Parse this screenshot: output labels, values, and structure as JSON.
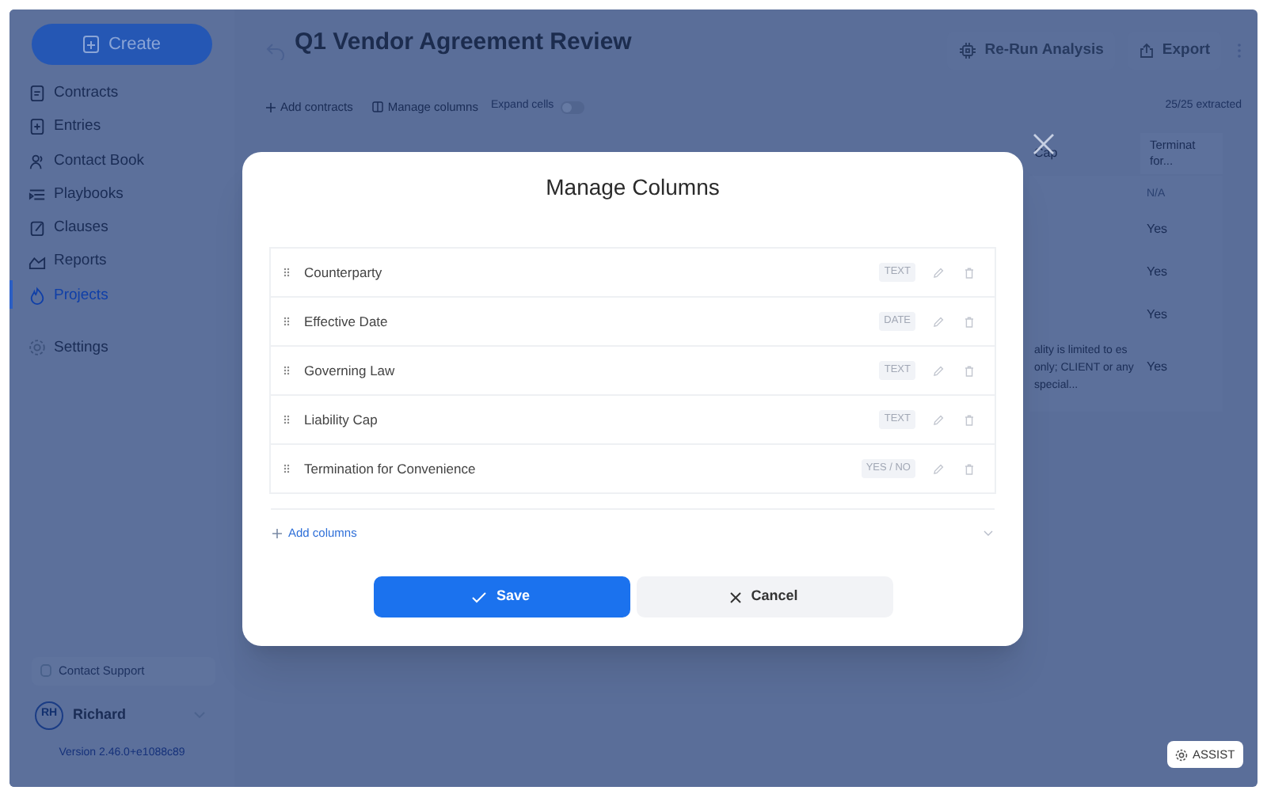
{
  "sidebar": {
    "create_button": "Create",
    "items": [
      {
        "label": "Contracts",
        "selected": false
      },
      {
        "label": "Entries",
        "selected": false
      },
      {
        "label": "Contact Book",
        "selected": false
      },
      {
        "label": "Playbooks",
        "selected": false
      },
      {
        "label": "Clauses",
        "selected": false
      },
      {
        "label": "Reports",
        "selected": false
      },
      {
        "label": "Projects",
        "selected": true
      }
    ],
    "settings": "Settings",
    "contact_support": "Contact Support",
    "user": {
      "initials": "RH",
      "name": "Richard"
    },
    "version": "Version 2.46.0+e1088c89"
  },
  "header": {
    "title": "Q1 Vendor Agreement Review",
    "rerun_button": "Re-Run Analysis",
    "export_button": "Export"
  },
  "toolbar": {
    "add_contracts": "Add contracts",
    "manage_columns": "Manage columns",
    "expand_cells": {
      "label": "Expand cells",
      "on": false
    },
    "extracted": "25/25 extracted"
  },
  "table": {
    "columns": [
      "Cap",
      "Terminat for..."
    ],
    "rows": [
      [
        "",
        "N/A"
      ],
      [
        "",
        "Yes"
      ],
      [
        "",
        "Yes"
      ],
      [
        "",
        "Yes"
      ],
      [
        "ality is limited to es only; CLIENT or any special...",
        "Yes"
      ]
    ]
  },
  "modal": {
    "title": "Manage Columns",
    "columns": [
      {
        "name": "Counterparty",
        "type": "TEXT"
      },
      {
        "name": "Effective Date",
        "type": "DATE"
      },
      {
        "name": "Governing Law",
        "type": "TEXT"
      },
      {
        "name": "Liability Cap",
        "type": "TEXT"
      },
      {
        "name": "Termination for Convenience",
        "type": "YES / NO"
      }
    ],
    "add_columns": "Add columns",
    "save_button": "Save",
    "cancel_button": "Cancel"
  },
  "assist_button": "ASSIST"
}
